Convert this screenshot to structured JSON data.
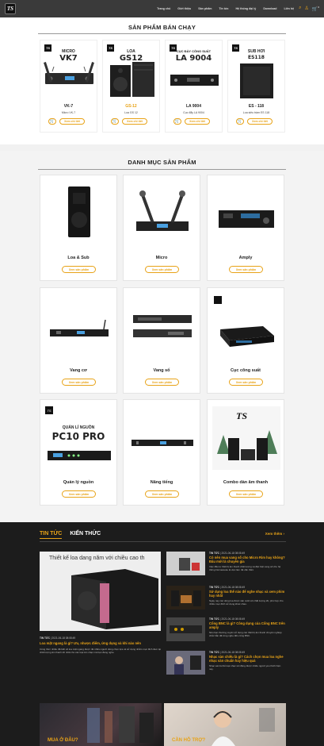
{
  "header": {
    "logo_text": "TS",
    "nav": [
      "Trang chủ",
      "Giới thiệu",
      "Sản phẩm",
      "Tin tức",
      "Hệ thống đại lý",
      "Download",
      "Liên hệ"
    ],
    "icons": [
      "search-icon",
      "user-icon",
      "cart-icon"
    ],
    "cart_count": "0"
  },
  "best_sellers": {
    "title": "SẢN PHẨM BÁN CHẠY",
    "products": [
      {
        "line1": "MICRO",
        "line2": "VK7",
        "code": "VK-7",
        "name": "Micro VK-7",
        "code_color": "#222"
      },
      {
        "line1": "LOA",
        "line2": "GS12",
        "code": "GS-12",
        "name": "Loa GS 12",
        "code_color": "#e8a317"
      },
      {
        "line1": "CỤC ĐẨY CÔNG SUẤT",
        "line2": "LA 9004",
        "code": "LA 9004",
        "name": "Cục đẩy LA 9004",
        "code_color": "#222"
      },
      {
        "line1": "SUB HƠI",
        "line2": "ES118",
        "code": "ES - 118",
        "name": "Loa siêu trầm ES 118",
        "code_color": "#222"
      }
    ],
    "view_label": "Xem chi tiết"
  },
  "categories": {
    "title": "DANH MỤC SẢN PHẨM",
    "button_label": "Xem sản phẩm",
    "items": [
      {
        "name": "Loa & Sub"
      },
      {
        "name": "Micro"
      },
      {
        "name": "Amply"
      },
      {
        "name": "Vang cơ"
      },
      {
        "name": "Vang số"
      },
      {
        "name": "Cục công suất"
      },
      {
        "name": "Quản lý nguồn"
      },
      {
        "name": "Nâng tiếng"
      },
      {
        "name": "Combo dàn âm thanh"
      }
    ],
    "pc10_line1": "QUẢN LÍ NGUỒN",
    "pc10_line2": "PC10 PRO"
  },
  "news": {
    "tabs": [
      "TIN TỨC",
      "KIẾN THỨC"
    ],
    "more": "Xem thêm",
    "featured": {
      "image_caption": "Thiết kế loa dang năm với chiều cao th",
      "category": "TIN TỨC",
      "date": "2021-06-18 08:08:49",
      "title": "Loa mặt ngang là gì? Ưu, nhược điểm, ứng dụng và khi nào nên",
      "excerpt": "Công thức nhiều đã biết về loa mặt ngang được rất nhiều người dùng chọn lựa và sử dụng nhằm mục đích đem lại chất lượng âm thanh tốt nhất cho các loại âm nhạc mà bạn đang nghe."
    },
    "side": [
      {
        "category": "TIN TỨC",
        "date": "2021-06-18 08:08:49",
        "title": "Có nên mua vang số cho Micro Rim hay không? Đâu mới là chuyên gia",
        "excerpt": "Việc đầu tư thiết bị âm thanh chất lượng và đặc biệt vang số cho hệ thống hát karaoke là việc làm rất cần thiết."
      },
      {
        "category": "TIN TỨC",
        "date": "2021-06-18 08:08:49",
        "title": "Sử dụng loa thế nào để nghe nhạc và xem phim hay nhất",
        "excerpt": "Ngày nay các dòng loa được sản xuất với chất lượng tốt, phù hợp cho nhiều mục đích sử dụng khác nhau."
      },
      {
        "category": "TIN TỨC",
        "date": "2021-06-18 08:08:49",
        "title": "Cổng BNC là gì? Công dụng của Cổng BNC trên amply",
        "excerpt": "Nếu bạn thường xuyên sử dụng các thiết bị âm thanh chuyên nghiệp chắc hẳn đã từng nghe đến cổng BNC."
      },
      {
        "category": "TIN TỨC",
        "date": "2021-06-18 08:08:49",
        "title": "Nhạc sàn chiếu là gì? Cách chọn mua loa nghe nhạc sàn chuẩn hay hiệu quả",
        "excerpt": "Nhạc sàn là thể loại nhạc sôi động được nhiều người yêu thích hiện nay."
      }
    ]
  },
  "banners": [
    {
      "label": "MUA Ở ĐÂU?"
    },
    {
      "label": "CẦN HỖ TRỢ?"
    }
  ]
}
